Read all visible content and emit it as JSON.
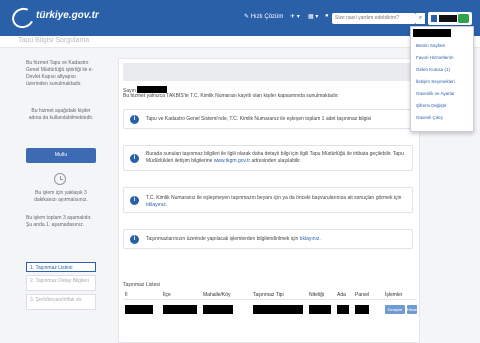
{
  "header": {
    "logo_text": "türkiye.gov.tr",
    "quick_solution": "Hızlı Çözüm",
    "pin_label": "▾",
    "grid_label": "▾",
    "search_placeholder": "Size nasıl yardım edebilirim?",
    "search_icon": "search-icon"
  },
  "subheader": {
    "title": "Tapu Bilgisi Sorgulama"
  },
  "sidebar": {
    "intro": "Bu hizmet Tapu ve Kadastro Genel Müdürlüğü işbirliği ile e-Devlet Kapısı altyapısı üzerinden sunulmaktadır.",
    "contact": "Bu hizmet aşağıdaki kişiler adına da kullanılabilmektedir.",
    "button_label": "Mutlu",
    "time_note": "Bu işlem için yaklaşık 3 dakikanızı ayırmalısınız.",
    "steps_note": "Bu işlem toplam 3 aşamalıdır. Şu anda 1. aşamadasınız.",
    "steps": [
      "1. Taşınmaz Listesi",
      "2. Taşınmaz Detay Bilgileri",
      "3. Şerh/beyan/irtifak vb."
    ]
  },
  "main": {
    "greeting": "Sayın",
    "note": "Bu hizmet yalnızca TAKBİS'te T.C. Kimlik Numarası kayıtlı olan kişiler kapsamında sunulmaktadır.",
    "info1": "Tapu ve Kadastro Genel Sistemi'nde, T.C. Kimlik Numaranız ile eşleşen toplam 1 adet taşınmaz bilgisi",
    "info2_a": "Burada sunulan taşınmaz bilgileri ile ilgili olarak daha detaylı bilgi için ilgili Tapu Müdürlüğü ile irtibata geçilebilir. Tapu Müdürlükleri iletişim bilgilerine ",
    "info2_link": "www.tkgm.gov.tr",
    "info2_b": " adresinden ulaşılabilir.",
    "info3_a": "T.C. Kimlik Numaranız ile eşleşmeyen taşınmazın beyanı için ya da önceki başvurularınıza ait sonuçları görmek için ",
    "info3_link": "tıklayınız",
    "info3_b": ".",
    "info4_a": "Taşınmazlarınızın üzerinde yapılacak işlemlerden bilgilendirilmek için ",
    "info4_link": "tıklayınız",
    "info4_b": ".",
    "table": {
      "title": "Taşınmaz Listesi",
      "columns": [
        "İl",
        "İlçe",
        "Mahalle/Köy",
        "Taşınmaz Tipi",
        "Niteliği",
        "Ada",
        "Parsel",
        "İşlemler"
      ],
      "actions": [
        "Detaylar",
        "Hisse Bilgileri"
      ]
    }
  },
  "dropdown": {
    "items": [
      "Benim Sayfam",
      "Favori Hizmetlerim",
      "Gelen Kutusu (1)",
      "İletişim Seçenekleri",
      "Güvenlik ve Ayarlar",
      "Şifremi Değiştir",
      "Güvenli Çıkış"
    ]
  },
  "colors": {
    "brand_blue": "#2a60a8",
    "button_blue": "#3d6bb3",
    "badge_green": "#31a24c"
  }
}
